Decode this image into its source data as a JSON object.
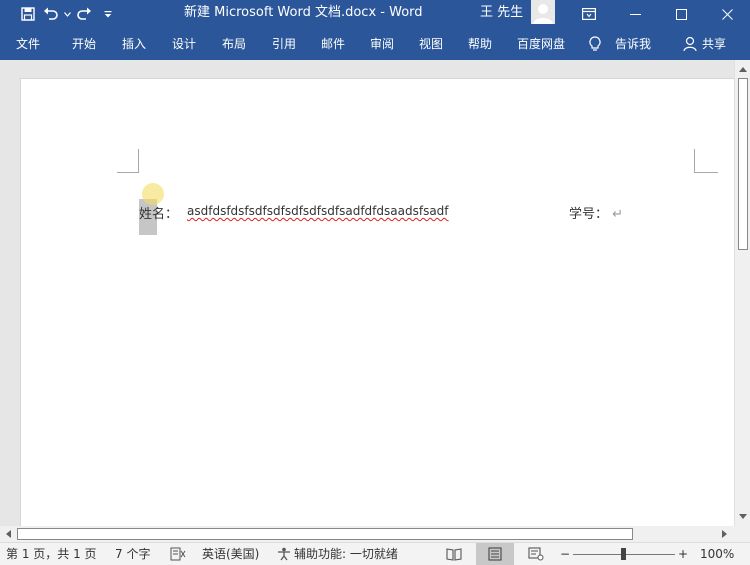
{
  "window": {
    "title": "新建 Microsoft Word 文档.docx  -  Word",
    "user_name": "王 先生"
  },
  "ribbon": {
    "tabs": [
      "文件",
      "开始",
      "插入",
      "设计",
      "布局",
      "引用",
      "邮件",
      "审阅",
      "视图",
      "帮助",
      "百度网盘"
    ],
    "tell_me": "告诉我",
    "share": "共享"
  },
  "document": {
    "name_label": "姓名",
    "colon1": "：",
    "name_value": "asdfdsfdsfsdfsdfsdfsdfsdfsadfdfdsaadsfsadf",
    "id_label": "学号",
    "colon2": "：",
    "paragraph_mark": "↵"
  },
  "status_bar": {
    "page_info": "第 1 页，共 1 页",
    "word_count": "7 个字",
    "language": "英语(美国)",
    "accessibility": "辅助功能: 一切就绪",
    "zoom_out": "−",
    "zoom_in": "+",
    "zoom": "100%"
  },
  "colors": {
    "ribbon_blue": "#2b579a",
    "page_bg": "#ffffff",
    "workspace_bg": "#e6e6e6",
    "spell_error": "#e02020"
  },
  "icons": [
    "save-icon",
    "undo-icon",
    "redo-icon",
    "customize-qat-icon",
    "ribbon-display-icon",
    "minimize-icon",
    "maximize-icon",
    "close-icon",
    "lightbulb-icon",
    "share-person-icon",
    "macro-record-icon",
    "accessibility-icon",
    "read-mode-icon",
    "print-layout-icon",
    "web-layout-icon"
  ]
}
